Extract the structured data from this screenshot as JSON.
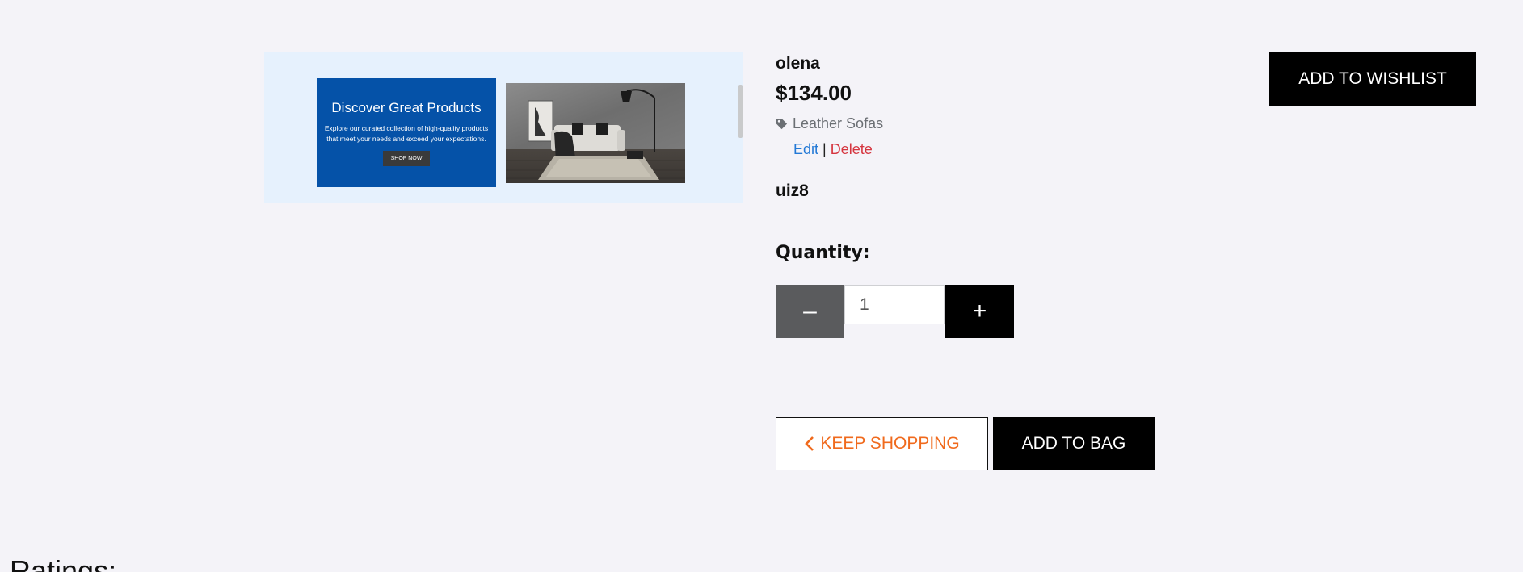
{
  "promo": {
    "title": "Discover Great Products",
    "text": "Explore our curated collection of high-quality products that meet your needs and exceed your expectations.",
    "button_label": "SHOP NOW"
  },
  "product": {
    "name": "olena",
    "price": "$134.00",
    "category": "Leather Sofas",
    "edit_label": "Edit",
    "separator": "|",
    "delete_label": "Delete",
    "sku": "uiz8"
  },
  "quantity": {
    "label": "Quantity:",
    "value": "1",
    "minus_label": "–",
    "plus_label": "+"
  },
  "actions": {
    "wishlist_label": "ADD TO WISHLIST",
    "keep_shopping_label": "KEEP SHOPPING",
    "add_to_bag_label": "ADD TO BAG"
  },
  "ratings": {
    "heading": "Ratings:"
  },
  "icons": {
    "category": "tag-icon",
    "keep_shopping": "chevron-left-icon"
  },
  "colors": {
    "page_background": "#f4f3f8",
    "promo_blue": "#0552a8",
    "edit_link": "#2379d6",
    "delete_link": "#d5343e",
    "keep_shopping_text": "#f06a1d",
    "primary_button": "#000000",
    "minus_button": "#5a5b5d"
  }
}
